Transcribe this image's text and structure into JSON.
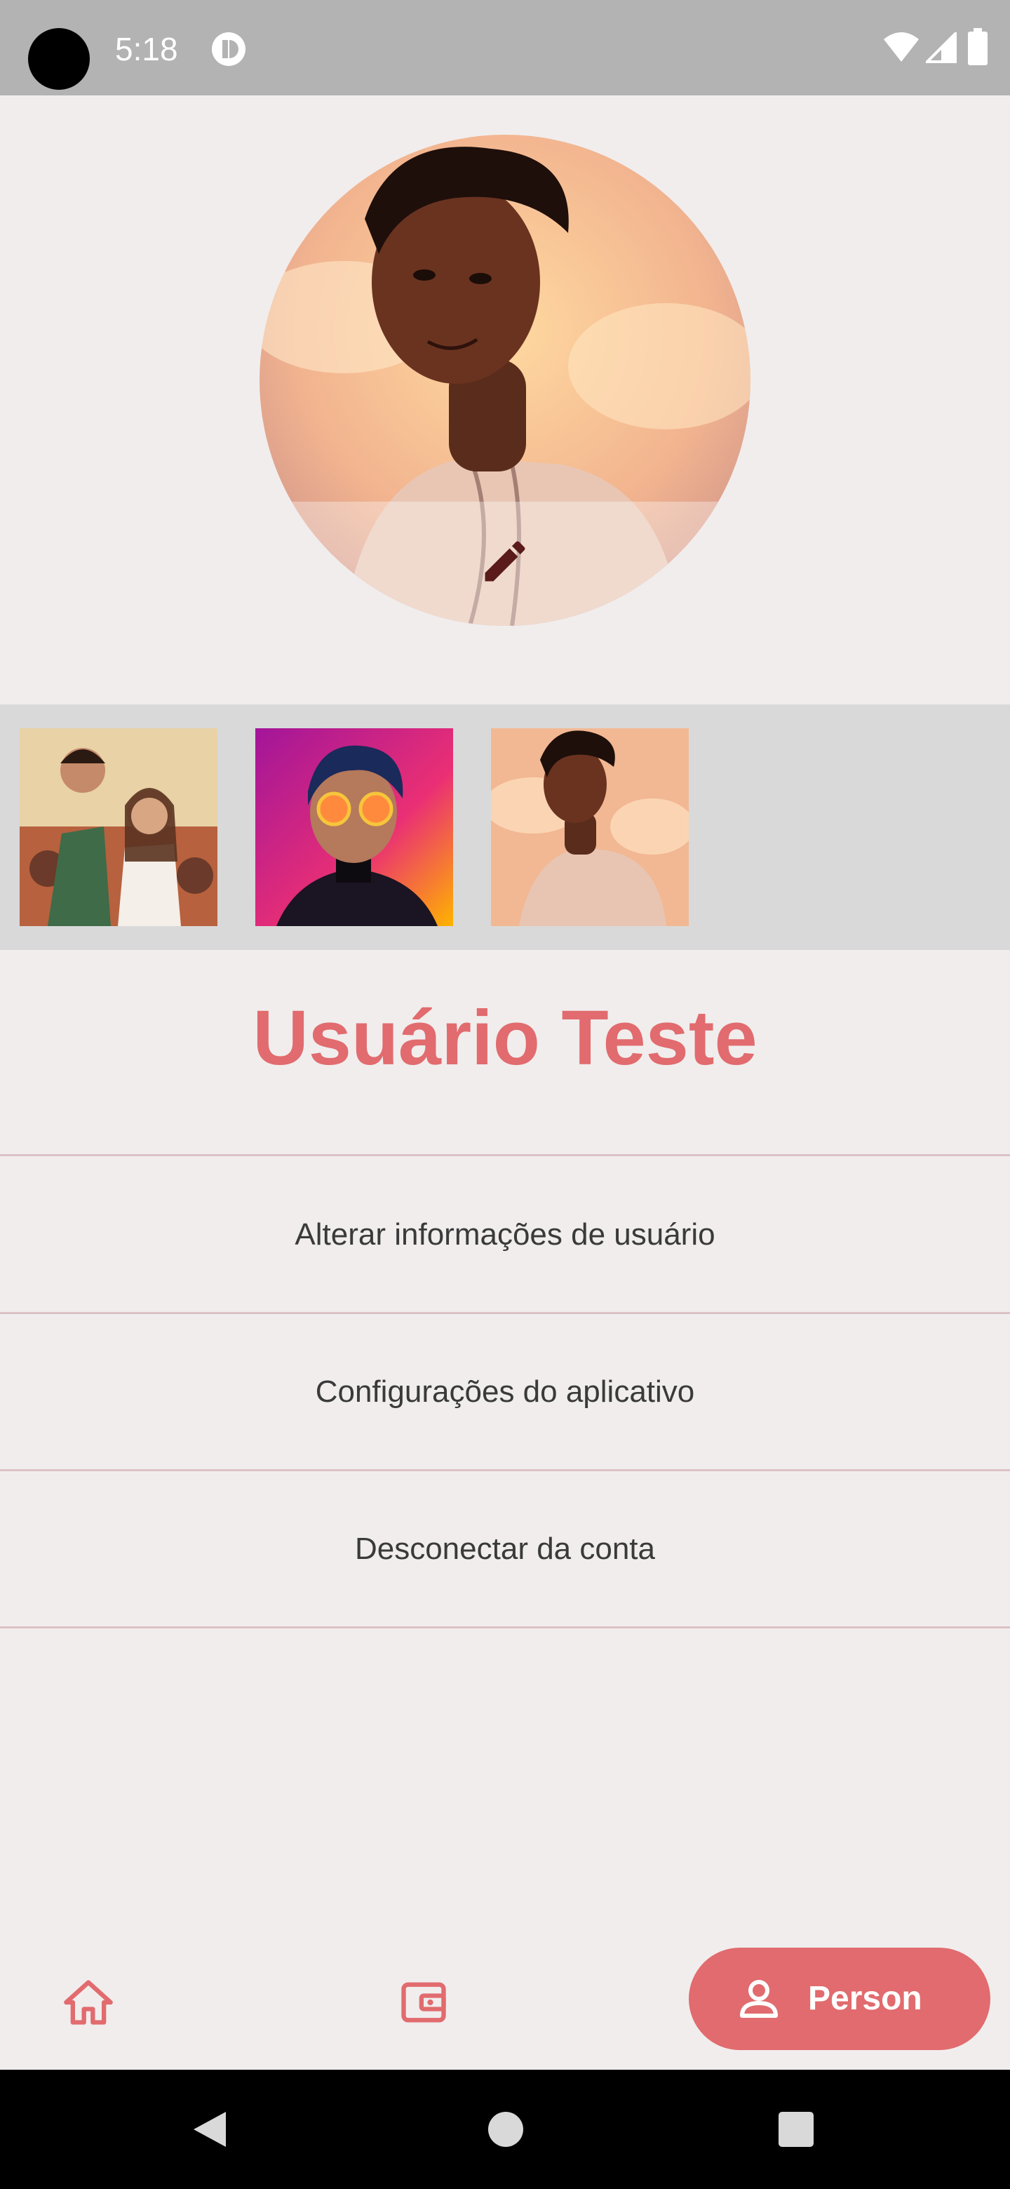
{
  "status_bar": {
    "time": "5:18",
    "icons": [
      "camera-cutout",
      "app-notification-icon",
      "wifi-icon",
      "signal-icon",
      "battery-icon"
    ]
  },
  "profile": {
    "avatar_name": "avatar",
    "edit_icon": "pencil-icon",
    "username": "Usuário Teste"
  },
  "gallery": {
    "thumbnails": [
      "avatar-option-group",
      "avatar-option-sunglasses",
      "avatar-option-hoodie"
    ]
  },
  "menu": {
    "items": [
      {
        "label": "Alterar informações de usuário"
      },
      {
        "label": "Configurações do aplicativo"
      },
      {
        "label": "Desconectar da conta"
      }
    ]
  },
  "bottom_nav": {
    "items": [
      {
        "icon": "home-icon"
      },
      {
        "icon": "wallet-icon"
      },
      {
        "icon": "person-icon",
        "label": "Person",
        "selected": true
      }
    ]
  },
  "colors": {
    "accent": "#e16b6e",
    "background": "#f1eded",
    "gallery_bg": "#d9d9d9",
    "divider": "#dcc2c5",
    "status_bar": "#b3b3b3"
  }
}
